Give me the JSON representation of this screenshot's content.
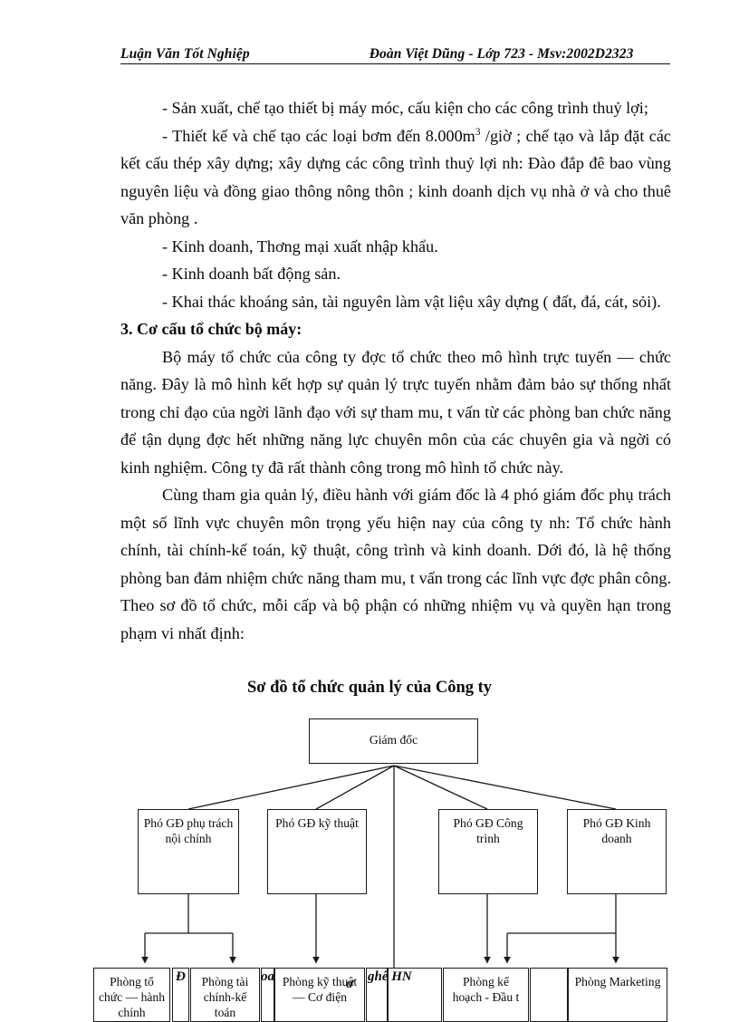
{
  "header": {
    "left": "Luận Văn Tốt Nghiệp",
    "right": "Đoàn Việt Dũng - Lớp 723 - Msv:2002D2323"
  },
  "body": {
    "p1": "- Sản xuất, chế tạo thiết bị máy móc, cấu kiện cho các công trình thuỷ lợi;",
    "p2_a": "- Thiết kế và chế tạo các loại bơm đến 8.000m",
    "p2_sup": "3",
    "p2_b": " /giờ ; chế tạo và lắp đặt các kết cấu thép xây dựng; xây dựng các công trình thuỷ lợi nh:  Đào đắp đê bao vùng nguyên liệu và đồng   giao thông  nông thôn ; kinh doanh dịch vụ nhà ở và cho thuê văn phòng .",
    "p3": "- Kinh doanh, Thơng   mại xuất nhập khẩu.",
    "p4": "- Kinh doanh bất động sản.",
    "p5": "- Khai thác khoáng sản, tài nguyên làm vật liệu xây dựng ( đất, đá,  cát, sỏi).",
    "heading3": "3. Cơ cấu tổ chức bộ máy:",
    "p6": "Bộ máy tổ chức của công ty đợc   tổ chức theo mô hình trực tuyến — chức năng. Đây là mô hình kết hợp sự quản lý trực tuyến nhằm đảm bảo sự thống nhất trong chỉ đạo của ngời   lãnh đạo với sự tham mu,   t   vấn từ các phòng ban chức năng để tận dụng đợc   hết những năng lực chuyên môn của các chuyên gia và ngời   có kinh nghiệm. Công ty đã rất thành công trong mô hình tổ chức này.",
    "p7": "Cùng tham gia quản lý, điều hành với giám đốc là 4 phó giám đốc phụ trách một số lĩnh vực chuyên môn trọng yếu hiện nay của công ty nh:  Tổ chức hành chính, tài chính-kế toán, kỹ thuật, công trình và kinh doanh. Dới đó, là hệ thống phòng ban đảm nhiệm chức năng tham mu,   t   vấn trong các lĩnh vực đợc   phân công. Theo sơ đồ tổ chức, mỗi cấp và bộ phận có những nhiệm vụ và quyền hạn trong phạm vi nhất định:"
  },
  "org_chart": {
    "title": "Sơ đồ tổ chức quản lý của Công ty",
    "root": "Giám đốc",
    "level2": [
      "Phó GĐ phụ trách nội chính",
      "Phó GĐ kỹ thuật",
      "Phó GĐ Công trình",
      "Phó GĐ Kinh doanh"
    ],
    "level3": [
      "Phòng tổ chức — hành chính",
      "Phòng tài chính-kế toán",
      "Phòng kỹ thuật — Cơ điện",
      "Phòng kế hoạch - Đầu t",
      "Phòng Marketing"
    ],
    "overlay_fragments": [
      "Đ",
      "oa",
      "ghê HN",
      "ơ"
    ]
  }
}
